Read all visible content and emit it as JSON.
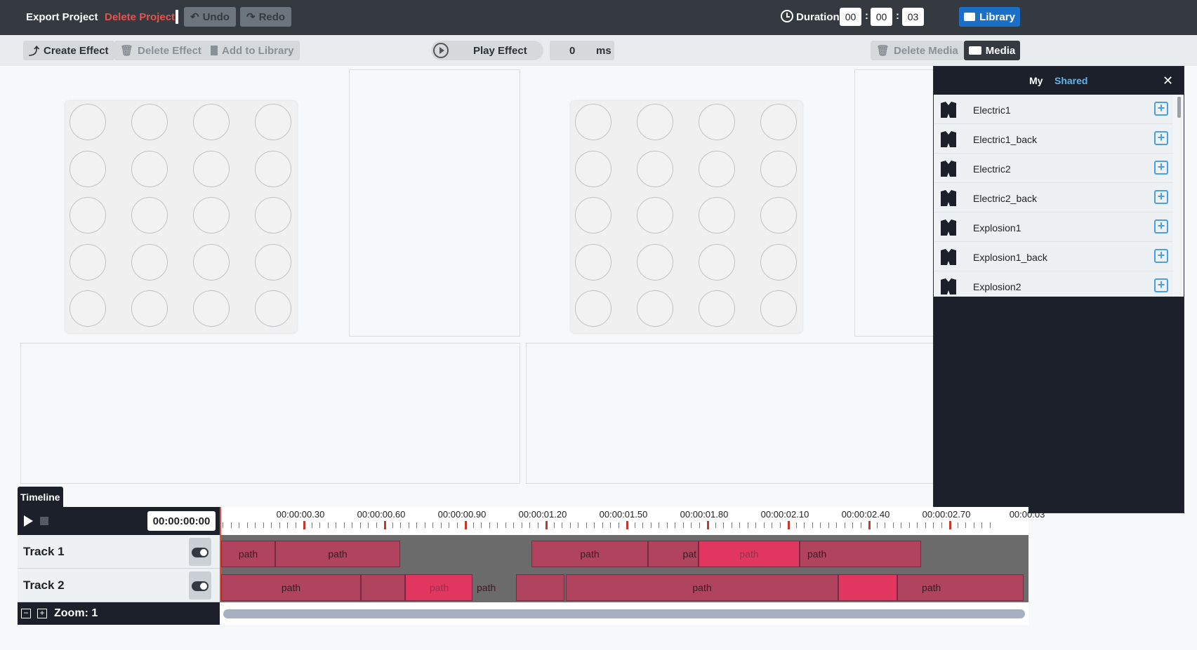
{
  "topbar": {
    "export_label": "Export Project",
    "delete_label": "Delete Project",
    "undo_label": "Undo",
    "redo_label": "Redo",
    "duration_label": "Duration",
    "duration": {
      "hours": "00",
      "minutes": "00",
      "seconds": "03"
    },
    "library_label": "Library"
  },
  "toolbar": {
    "create_effect": "Create Effect",
    "delete_effect": "Delete Effect",
    "add_to_library": "Add to Library",
    "play_effect": "Play Effect",
    "ms_value": "0",
    "ms_unit": "ms",
    "delete_media": "Delete Media",
    "media": "Media"
  },
  "media_panel": {
    "tab_my": "My",
    "tab_shared": "Shared",
    "close": "✕",
    "items": [
      {
        "name": "Electric1"
      },
      {
        "name": "Electric1_back"
      },
      {
        "name": "Electric2"
      },
      {
        "name": "Electric2_back"
      },
      {
        "name": "Explosion1"
      },
      {
        "name": "Explosion1_back"
      },
      {
        "name": "Explosion2"
      }
    ]
  },
  "timeline": {
    "tab_label": "Timeline",
    "current_time": "00:00:00:00",
    "ticks": [
      "00:00:00.30",
      "00:00:00.60",
      "00:00:00.90",
      "00:00:01.20",
      "00:00:01.50",
      "00:00:01.80",
      "00:00:02.10",
      "00:00:02.40",
      "00:00:02.70",
      "00:00:03"
    ],
    "tracks": [
      {
        "name": "Track 1",
        "clips": [
          "path",
          "path",
          "path",
          "pat",
          "path",
          "path"
        ]
      },
      {
        "name": "Track 2",
        "clips": [
          "path",
          "",
          "path",
          "path",
          "",
          "path",
          "",
          "path"
        ]
      }
    ],
    "zoom_label": "Zoom: 1"
  },
  "colors": {
    "accent": "#1c6fc7",
    "danger": "#e55353",
    "clip": "#b0445f",
    "clip_hot": "#e0365f",
    "dark": "#343a40"
  }
}
